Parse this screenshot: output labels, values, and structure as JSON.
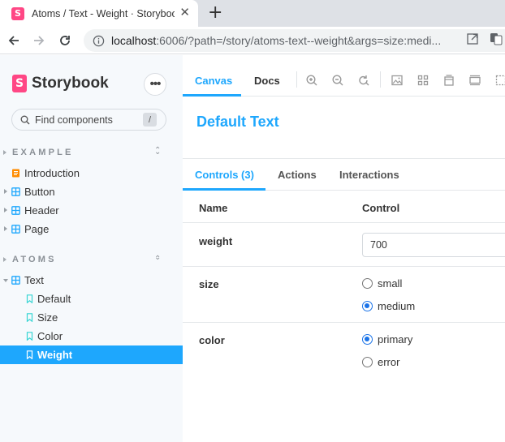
{
  "browser": {
    "tab_title": "Atoms / Text - Weight · Storybook",
    "tab_close": "✕",
    "new_tab": "+",
    "url_host": "localhost",
    "url_rest": ":6006/?path=/story/atoms-text--weight&args=size:medi..."
  },
  "sidebar": {
    "brand_letter": "S",
    "brand_name": "Storybook",
    "menu_label": "•••",
    "search_placeholder": "Find components",
    "search_shortcut": "/",
    "groups": [
      {
        "title": "EXAMPLE",
        "items": [
          {
            "label": "Introduction",
            "icon": "document-icon"
          },
          {
            "label": "Button",
            "icon": "component-icon"
          },
          {
            "label": "Header",
            "icon": "component-icon"
          },
          {
            "label": "Page",
            "icon": "component-icon"
          }
        ]
      },
      {
        "title": "ATOMS",
        "items": [
          {
            "label": "Text",
            "icon": "component-icon"
          },
          {
            "label": "Default",
            "icon": "bookmark-icon"
          },
          {
            "label": "Size",
            "icon": "bookmark-icon"
          },
          {
            "label": "Color",
            "icon": "bookmark-icon"
          },
          {
            "label": "Weight",
            "icon": "bookmark-icon",
            "selected": true
          }
        ]
      }
    ]
  },
  "main": {
    "tabs": [
      "Canvas",
      "Docs"
    ],
    "active_tab": "Canvas",
    "preview_text": "Default Text",
    "addon_tabs": [
      "Controls (3)",
      "Actions",
      "Interactions"
    ],
    "active_addon": "Controls (3)"
  },
  "controls": {
    "header_name": "Name",
    "header_control": "Control",
    "weight": {
      "name": "weight",
      "value": "700"
    },
    "size": {
      "name": "size",
      "options": [
        "small",
        "medium"
      ],
      "selected": "medium"
    },
    "color": {
      "name": "color",
      "options": [
        "primary",
        "error"
      ],
      "selected": "primary"
    }
  },
  "colors": {
    "accent": "#1ea7fd",
    "brand": "#ff4785",
    "sidebar_bg": "#f6f9fc"
  }
}
